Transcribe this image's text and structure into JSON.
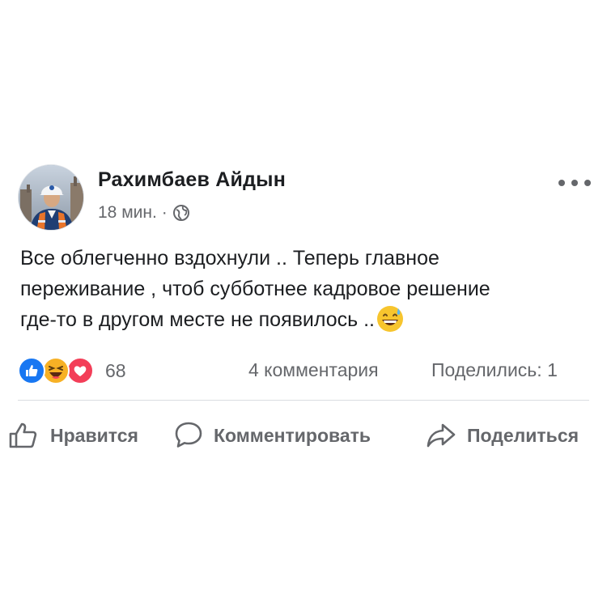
{
  "post": {
    "author_name": "Рахимбаев Айдын",
    "timestamp": "18 мин.",
    "separator": "·",
    "privacy_icon": "globe-icon",
    "more_icon": "more-horizontal-icon",
    "text_lines": [
      "Все облегченно вздохнули .. Теперь главное",
      "переживание , чтоб субботнее кадровое решение",
      "где-то в другом месте не появилось .."
    ],
    "trailing_emoji": "grinning-sweat-emoji"
  },
  "reactions": {
    "icons": [
      "like-reaction-icon",
      "haha-reaction-icon",
      "love-reaction-icon"
    ],
    "count": "68",
    "comments": "4 комментария",
    "shares": "Поделились: 1"
  },
  "actions": {
    "like_label": "Нравится",
    "comment_label": "Комментировать",
    "share_label": "Поделиться"
  },
  "colors": {
    "text": "#1c1e21",
    "secondary": "#65676b",
    "like_blue": "#1877f2",
    "love_red": "#f33e58",
    "haha_yellow": "#f7b125",
    "divider": "#dadde1"
  }
}
